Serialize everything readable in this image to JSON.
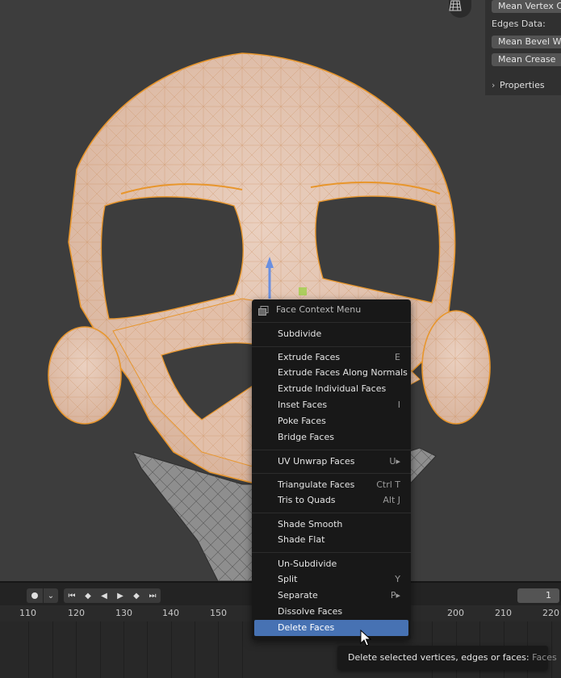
{
  "n_panel": {
    "mean_vertex_label": "Mean Vertex C",
    "edges_data_label": "Edges Data:",
    "mean_bevel_label": "Mean Bevel W",
    "mean_crease_label": "Mean Crease",
    "properties_label": "Properties"
  },
  "context_menu": {
    "title": "Face Context Menu",
    "items": [
      {
        "label": "Subdivide",
        "shortcut": ""
      },
      {
        "label": "Extrude Faces",
        "shortcut": "E"
      },
      {
        "label": "Extrude Faces Along Normals",
        "shortcut": ""
      },
      {
        "label": "Extrude Individual Faces",
        "shortcut": ""
      },
      {
        "label": "Inset Faces",
        "shortcut": "I"
      },
      {
        "label": "Poke Faces",
        "shortcut": ""
      },
      {
        "label": "Bridge Faces",
        "shortcut": ""
      },
      {
        "label": "UV Unwrap Faces",
        "shortcut": "U▸"
      },
      {
        "label": "Triangulate Faces",
        "shortcut": "Ctrl T"
      },
      {
        "label": "Tris to Quads",
        "shortcut": "Alt J"
      },
      {
        "label": "Shade Smooth",
        "shortcut": ""
      },
      {
        "label": "Shade Flat",
        "shortcut": ""
      },
      {
        "label": "Un-Subdivide",
        "shortcut": ""
      },
      {
        "label": "Split",
        "shortcut": "Y"
      },
      {
        "label": "Separate",
        "shortcut": "P▸"
      },
      {
        "label": "Dissolve Faces",
        "shortcut": ""
      },
      {
        "label": "Delete Faces",
        "shortcut": ""
      }
    ]
  },
  "tooltip": {
    "text": "Delete selected vertices, edges or faces:",
    "python": "Faces"
  },
  "timeline": {
    "current_frame": "1",
    "ticks": [
      "110",
      "120",
      "130",
      "140",
      "150",
      "200",
      "210",
      "220"
    ]
  },
  "colors": {
    "accent": "#4772b3",
    "mesh_fill": "#e3c2ae",
    "mesh_edge": "#e8962c",
    "menu_bg": "#181818"
  }
}
